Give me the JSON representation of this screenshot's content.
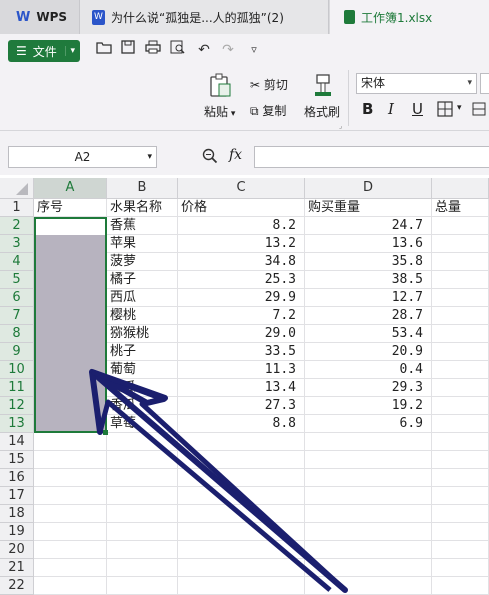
{
  "tabs": [
    {
      "label": "WPS",
      "icon": "wps-logo-icon"
    },
    {
      "label": "为什么说“孤独是...人的孤独”(2)",
      "icon": "word-doc-icon"
    },
    {
      "label": "工作簿1.xlsx",
      "icon": "spreadsheet-icon"
    }
  ],
  "toolbar": {
    "file_label": "文件",
    "paste_label": "粘贴",
    "cut_label": "剪切",
    "copy_label": "复制",
    "format_painter_label": "格式刷",
    "font_name": "宋体",
    "bold": "B",
    "italic": "I",
    "underline": "U"
  },
  "formula_bar": {
    "name_box": "A2",
    "fx": "fx",
    "formula": ""
  },
  "columns": [
    "A",
    "B",
    "C",
    "D",
    "总量"
  ],
  "rows": [
    "1",
    "2",
    "3",
    "4",
    "5",
    "6",
    "7",
    "8",
    "9",
    "10",
    "11",
    "12",
    "13",
    "14",
    "15",
    "16",
    "17",
    "18",
    "19",
    "20",
    "21",
    "22"
  ],
  "header_row": {
    "a": "序号",
    "b": "水果名称",
    "c": "价格",
    "d": "购买重量",
    "e": "总量"
  },
  "data_rows": [
    {
      "name": "香蕉",
      "price": "8.2",
      "weight": "24.7"
    },
    {
      "name": "苹果",
      "price": "13.2",
      "weight": "13.6"
    },
    {
      "name": "菠萝",
      "price": "34.8",
      "weight": "35.8"
    },
    {
      "name": "橘子",
      "price": "25.3",
      "weight": "38.5"
    },
    {
      "name": "西瓜",
      "price": "29.9",
      "weight": "12.7"
    },
    {
      "name": "樱桃",
      "price": "7.2",
      "weight": "28.7"
    },
    {
      "name": "猕猴桃",
      "price": "29.0",
      "weight": "53.4"
    },
    {
      "name": "桃子",
      "price": "33.5",
      "weight": "20.9"
    },
    {
      "name": "葡萄",
      "price": "11.3",
      "weight": "0.4"
    },
    {
      "name": "甜瓜",
      "price": "13.4",
      "weight": "29.3"
    },
    {
      "name": "香瓜",
      "price": "27.3",
      "weight": "19.2"
    },
    {
      "name": "草莓",
      "price": "8.8",
      "weight": "6.9"
    }
  ],
  "colors": {
    "accent": "#1e7a3a",
    "annotation_arrow": "#1b1f6e",
    "selection_fill": "#b7b3bf"
  }
}
